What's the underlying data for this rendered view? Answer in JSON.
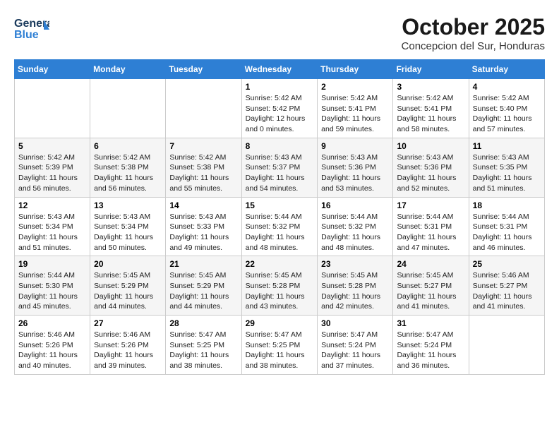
{
  "header": {
    "logo_general": "General",
    "logo_blue": "Blue",
    "month_title": "October 2025",
    "subtitle": "Concepcion del Sur, Honduras"
  },
  "days_of_week": [
    "Sunday",
    "Monday",
    "Tuesday",
    "Wednesday",
    "Thursday",
    "Friday",
    "Saturday"
  ],
  "weeks": [
    [
      {
        "day": "",
        "info": ""
      },
      {
        "day": "",
        "info": ""
      },
      {
        "day": "",
        "info": ""
      },
      {
        "day": "1",
        "info": "Sunrise: 5:42 AM\nSunset: 5:42 PM\nDaylight: 12 hours\nand 0 minutes."
      },
      {
        "day": "2",
        "info": "Sunrise: 5:42 AM\nSunset: 5:41 PM\nDaylight: 11 hours\nand 59 minutes."
      },
      {
        "day": "3",
        "info": "Sunrise: 5:42 AM\nSunset: 5:41 PM\nDaylight: 11 hours\nand 58 minutes."
      },
      {
        "day": "4",
        "info": "Sunrise: 5:42 AM\nSunset: 5:40 PM\nDaylight: 11 hours\nand 57 minutes."
      }
    ],
    [
      {
        "day": "5",
        "info": "Sunrise: 5:42 AM\nSunset: 5:39 PM\nDaylight: 11 hours\nand 56 minutes."
      },
      {
        "day": "6",
        "info": "Sunrise: 5:42 AM\nSunset: 5:38 PM\nDaylight: 11 hours\nand 56 minutes."
      },
      {
        "day": "7",
        "info": "Sunrise: 5:42 AM\nSunset: 5:38 PM\nDaylight: 11 hours\nand 55 minutes."
      },
      {
        "day": "8",
        "info": "Sunrise: 5:43 AM\nSunset: 5:37 PM\nDaylight: 11 hours\nand 54 minutes."
      },
      {
        "day": "9",
        "info": "Sunrise: 5:43 AM\nSunset: 5:36 PM\nDaylight: 11 hours\nand 53 minutes."
      },
      {
        "day": "10",
        "info": "Sunrise: 5:43 AM\nSunset: 5:36 PM\nDaylight: 11 hours\nand 52 minutes."
      },
      {
        "day": "11",
        "info": "Sunrise: 5:43 AM\nSunset: 5:35 PM\nDaylight: 11 hours\nand 51 minutes."
      }
    ],
    [
      {
        "day": "12",
        "info": "Sunrise: 5:43 AM\nSunset: 5:34 PM\nDaylight: 11 hours\nand 51 minutes."
      },
      {
        "day": "13",
        "info": "Sunrise: 5:43 AM\nSunset: 5:34 PM\nDaylight: 11 hours\nand 50 minutes."
      },
      {
        "day": "14",
        "info": "Sunrise: 5:43 AM\nSunset: 5:33 PM\nDaylight: 11 hours\nand 49 minutes."
      },
      {
        "day": "15",
        "info": "Sunrise: 5:44 AM\nSunset: 5:32 PM\nDaylight: 11 hours\nand 48 minutes."
      },
      {
        "day": "16",
        "info": "Sunrise: 5:44 AM\nSunset: 5:32 PM\nDaylight: 11 hours\nand 48 minutes."
      },
      {
        "day": "17",
        "info": "Sunrise: 5:44 AM\nSunset: 5:31 PM\nDaylight: 11 hours\nand 47 minutes."
      },
      {
        "day": "18",
        "info": "Sunrise: 5:44 AM\nSunset: 5:31 PM\nDaylight: 11 hours\nand 46 minutes."
      }
    ],
    [
      {
        "day": "19",
        "info": "Sunrise: 5:44 AM\nSunset: 5:30 PM\nDaylight: 11 hours\nand 45 minutes."
      },
      {
        "day": "20",
        "info": "Sunrise: 5:45 AM\nSunset: 5:29 PM\nDaylight: 11 hours\nand 44 minutes."
      },
      {
        "day": "21",
        "info": "Sunrise: 5:45 AM\nSunset: 5:29 PM\nDaylight: 11 hours\nand 44 minutes."
      },
      {
        "day": "22",
        "info": "Sunrise: 5:45 AM\nSunset: 5:28 PM\nDaylight: 11 hours\nand 43 minutes."
      },
      {
        "day": "23",
        "info": "Sunrise: 5:45 AM\nSunset: 5:28 PM\nDaylight: 11 hours\nand 42 minutes."
      },
      {
        "day": "24",
        "info": "Sunrise: 5:45 AM\nSunset: 5:27 PM\nDaylight: 11 hours\nand 41 minutes."
      },
      {
        "day": "25",
        "info": "Sunrise: 5:46 AM\nSunset: 5:27 PM\nDaylight: 11 hours\nand 41 minutes."
      }
    ],
    [
      {
        "day": "26",
        "info": "Sunrise: 5:46 AM\nSunset: 5:26 PM\nDaylight: 11 hours\nand 40 minutes."
      },
      {
        "day": "27",
        "info": "Sunrise: 5:46 AM\nSunset: 5:26 PM\nDaylight: 11 hours\nand 39 minutes."
      },
      {
        "day": "28",
        "info": "Sunrise: 5:47 AM\nSunset: 5:25 PM\nDaylight: 11 hours\nand 38 minutes."
      },
      {
        "day": "29",
        "info": "Sunrise: 5:47 AM\nSunset: 5:25 PM\nDaylight: 11 hours\nand 38 minutes."
      },
      {
        "day": "30",
        "info": "Sunrise: 5:47 AM\nSunset: 5:24 PM\nDaylight: 11 hours\nand 37 minutes."
      },
      {
        "day": "31",
        "info": "Sunrise: 5:47 AM\nSunset: 5:24 PM\nDaylight: 11 hours\nand 36 minutes."
      },
      {
        "day": "",
        "info": ""
      }
    ]
  ]
}
